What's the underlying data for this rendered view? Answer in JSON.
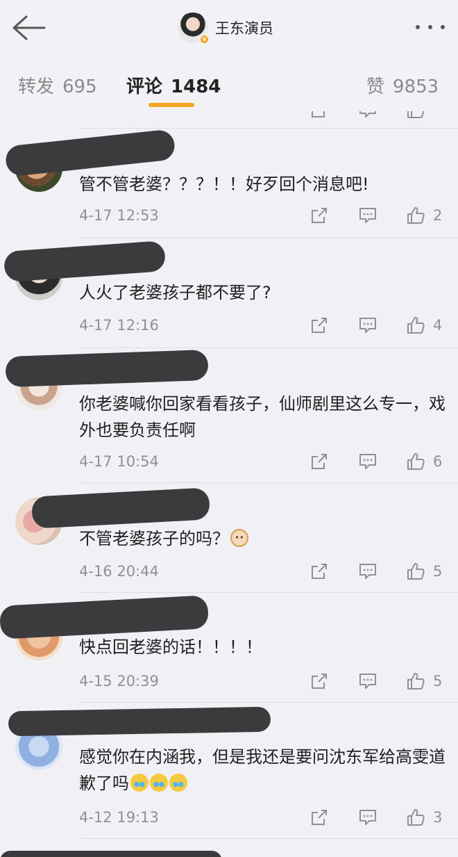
{
  "header": {
    "username": "王东演员",
    "back_icon": "arrow-left-icon",
    "more_icon": "more-dots-icon",
    "verified_badge": "V"
  },
  "tabs": [
    {
      "label": "转发",
      "count": "695"
    },
    {
      "label": "评论",
      "count": "1484"
    },
    {
      "label": "赞",
      "count": "9853"
    }
  ],
  "colors": {
    "accent": "#f5a623",
    "background": "#f1f0f5",
    "muted": "#8f8f96",
    "redaction": "#3b3b3d"
  },
  "comments": [
    {
      "text": "管不管老婆？？？！！好歹回个消息吧!",
      "date": "4-17 12:53",
      "likes": "2"
    },
    {
      "text": "人火了老婆孩子都不要了?",
      "date": "4-17 12:16",
      "likes": "4"
    },
    {
      "text": "你老婆喊你回家看看孩子，仙师剧里这么专一，戏外也要负责任啊",
      "date": "4-17 10:54",
      "likes": "6"
    },
    {
      "text": "不管老婆孩子的吗？",
      "date": "4-16 20:44",
      "likes": "5"
    },
    {
      "text": "快点回老婆的话！！！！",
      "date": "4-15 20:39",
      "likes": "5"
    },
    {
      "text": "感觉你在内涵我，但是我还是要问沈东军给高雯道歉了吗",
      "date": "4-12 19:13",
      "likes": "3"
    }
  ]
}
